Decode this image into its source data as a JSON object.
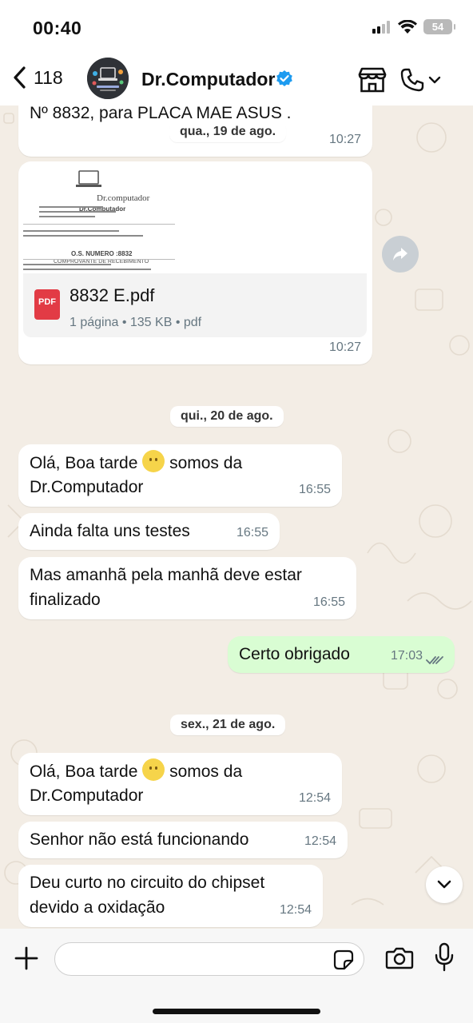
{
  "status_bar": {
    "time": "00:40",
    "battery": "54"
  },
  "header": {
    "back_count": "118",
    "contact_name": "Dr.Computador"
  },
  "messages": [
    {
      "text": "Nº 8832, para PLACA MÃE ASUS .",
      "time": "10:27"
    },
    {
      "pdf_name": "8832 E.pdf",
      "pdf_meta": "1 página • 135 KB • pdf",
      "time": "10:27"
    },
    {
      "text": "Olá, Boa tarde 🙂 somos da",
      "text2": "Dr.Computador",
      "time": "16:55"
    },
    {
      "text": "Ainda falta uns testes",
      "time": "16:55"
    },
    {
      "text": "Mas amanhã pela manhã deve estar",
      "text2": "finalizado",
      "time": "16:55"
    },
    {
      "text": "Certo obrigado",
      "time": "17:03"
    },
    {
      "text": "Olá, Boa tarde 🙂 somos da",
      "text2": "Dr.Computador",
      "time": "12:54"
    },
    {
      "text": "Senhor não está funcionando",
      "time": "12:54"
    },
    {
      "text": "Deu curto no circuito do chipset",
      "text2": "devido a oxidação",
      "time": "12:54"
    }
  ],
  "date_chips": [
    "qua., 19 de ago.",
    "qui., 20 de ago.",
    "sex., 21 de ago."
  ],
  "pdf_preview": {
    "title": "Dr.computador",
    "lines": [
      "Dr.Computador",
      "O.S. NUMERO :8832",
      "COMPROVANTE DE RECEBIMENTO"
    ]
  },
  "composer": {
    "placeholder": ""
  },
  "colors": {
    "chat_bg": "#f3ede5",
    "outgoing_bubble": "#d9fdd3",
    "verified": "#1d9bf0",
    "pdf_red": "#e23b45",
    "read_ticks": "#667781"
  }
}
